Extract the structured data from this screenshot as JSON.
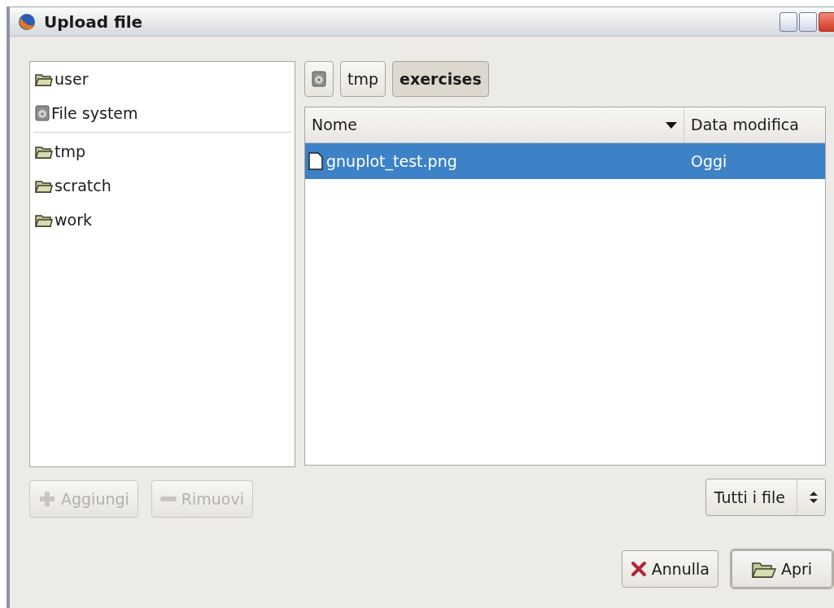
{
  "window": {
    "title": "Upload file"
  },
  "places": [
    {
      "kind": "folder",
      "label": "user"
    },
    {
      "kind": "drive",
      "label": "File system"
    }
  ],
  "bookmarks": [
    {
      "kind": "folder",
      "label": "tmp"
    },
    {
      "kind": "folder",
      "label": "scratch"
    },
    {
      "kind": "folder",
      "label": "work"
    }
  ],
  "place_buttons": [
    {
      "kind": "add",
      "label": "Aggiungi",
      "disabled": true
    },
    {
      "kind": "remove",
      "label": "Rimuovi",
      "disabled": true
    }
  ],
  "path_bar": [
    {
      "kind": "drive",
      "selected": false
    },
    {
      "kind": "text",
      "label": "tmp",
      "selected": false
    },
    {
      "kind": "text",
      "label": "exercises",
      "selected": true
    }
  ],
  "file_list": {
    "columns": [
      "Nome",
      "Data modifica"
    ],
    "rows": [
      {
        "name": "gnuplot_test.png",
        "modified": "Oggi",
        "selected": true
      }
    ]
  },
  "filter": {
    "value": "Tutti i file"
  },
  "buttons": [
    {
      "kind": "cancel",
      "label": "Annulla"
    },
    {
      "kind": "open",
      "label": "Apri"
    }
  ]
}
